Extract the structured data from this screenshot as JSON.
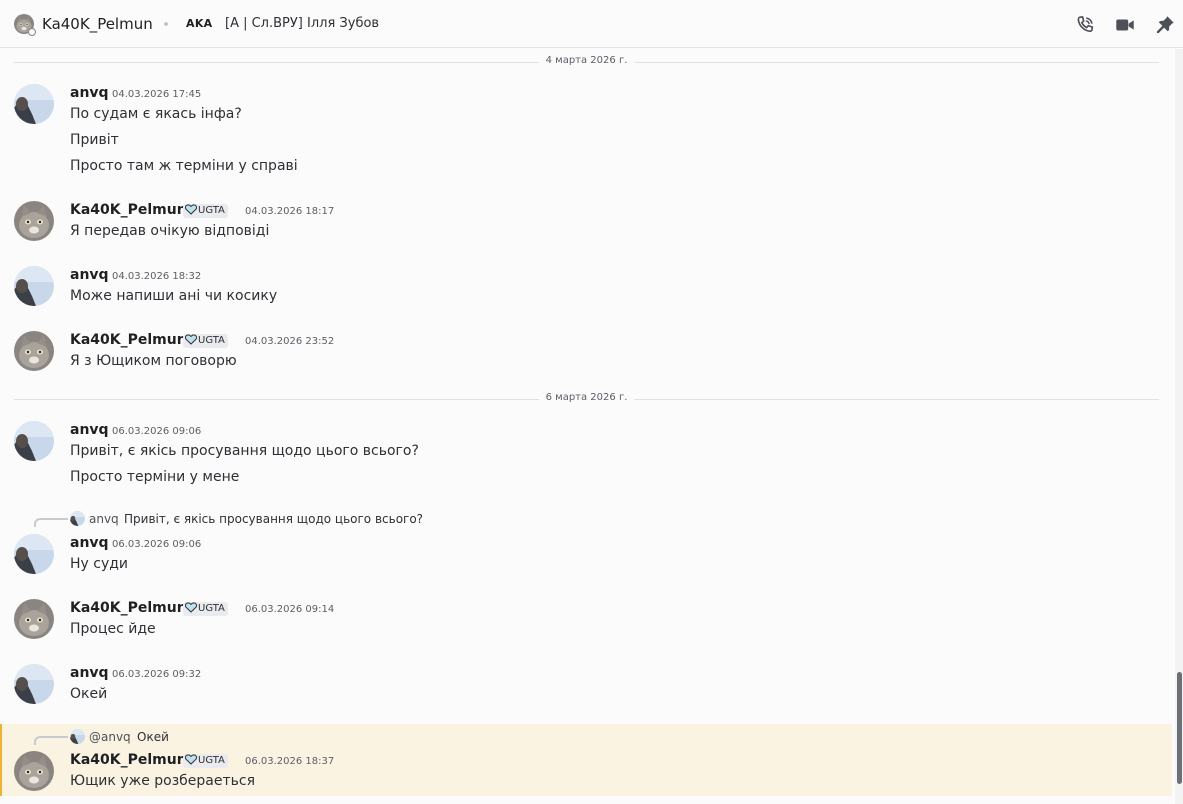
{
  "header": {
    "name": "Ka40K_Pelmun",
    "tag": "AKA",
    "alias": "[A | Сл.ВРУ] Ілля Зубов",
    "icons": [
      "phone-call-icon",
      "video-call-icon",
      "pin-icon"
    ]
  },
  "dividers": [
    "4 марта 2026 г.",
    "6 марта 2026 г."
  ],
  "messages": [
    {
      "author": "anvq",
      "time": "04.03.2026 17:45",
      "lines": [
        "По судам є якась інфа?",
        "Привіт",
        "Просто там ж терміни у справі"
      ]
    },
    {
      "author": "Ka40K_Pelmun",
      "badge": "UGTA",
      "time": "04.03.2026 18:17",
      "lines": [
        "Я передав очікую відповіді"
      ]
    },
    {
      "author": "anvq",
      "time": "04.03.2026 18:32",
      "lines": [
        "Може напиши ані чи косику"
      ]
    },
    {
      "author": "Ka40K_Pelmun",
      "badge": "UGTA",
      "time": "04.03.2026 23:52",
      "lines": [
        "Я з Ющиком поговорю"
      ]
    },
    {
      "author": "anvq",
      "time": "06.03.2026 09:06",
      "lines": [
        "Привіт, є якісь просування щодо цього всього?",
        "Просто терміни у мене"
      ]
    },
    {
      "author": "anvq",
      "time": "06.03.2026 09:06",
      "reply": {
        "author": "anvq",
        "text": "Привіт, є якісь просування щодо цього всього?"
      },
      "lines": [
        "Ну суди"
      ]
    },
    {
      "author": "Ka40K_Pelmun",
      "badge": "UGTA",
      "time": "06.03.2026 09:14",
      "lines": [
        "Процес йде"
      ]
    },
    {
      "author": "anvq",
      "time": "06.03.2026 09:32",
      "lines": [
        "Окей"
      ]
    },
    {
      "author": "Ka40K_Pelmun",
      "badge": "UGTA",
      "time": "06.03.2026 18:37",
      "reply": {
        "author": "@anvq",
        "text": "Окей"
      },
      "lines": [
        "Ющик уже розбераеться"
      ],
      "highlighted": true
    }
  ],
  "colors": {
    "background": "#fbfbfb",
    "mention_highlight": "#fbf3e2",
    "mention_bar": "#f0b232"
  }
}
